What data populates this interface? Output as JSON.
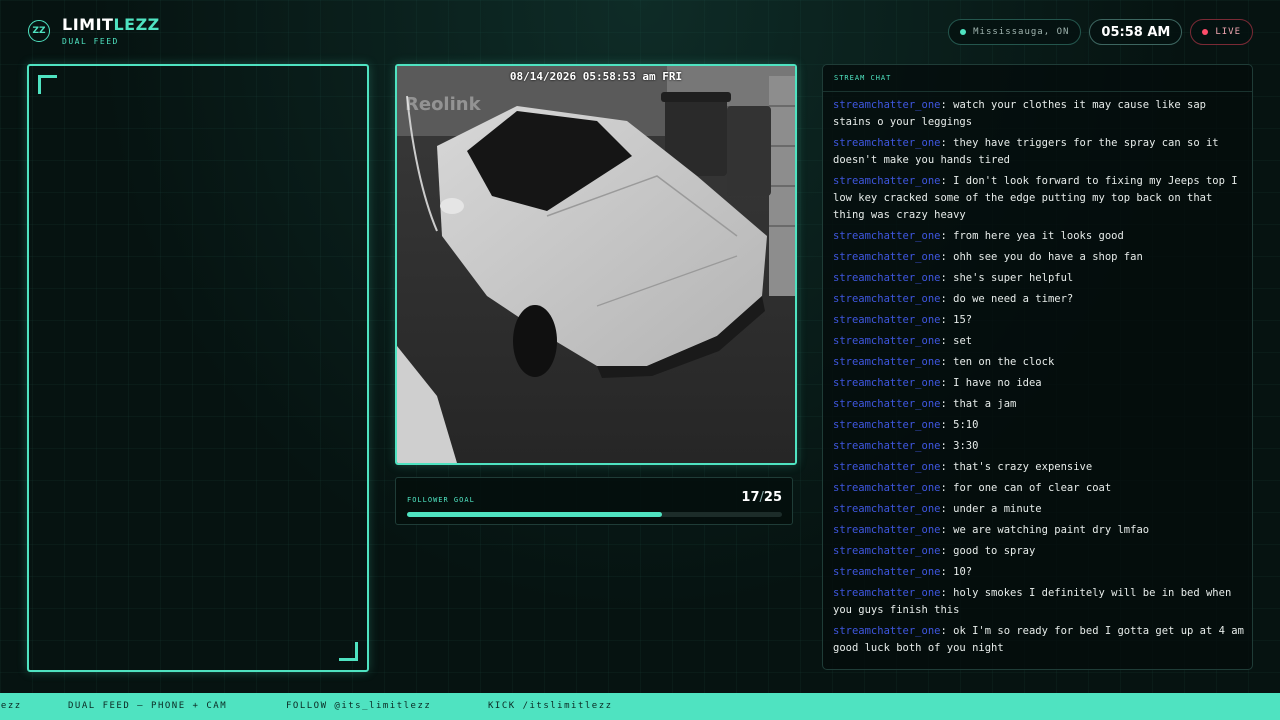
{
  "brand": {
    "logo_text": "ZZ",
    "name_part1": "LIMIT",
    "name_part2": "LEZZ",
    "subtitle": "DUAL FEED"
  },
  "status": {
    "location": "Mississauga, ON",
    "clock": "05:58 AM",
    "live_label": "LIVE"
  },
  "camera": {
    "timestamp": "08/14/2026 05:58:53 am FRI",
    "watermark": "Reolink"
  },
  "goal": {
    "label": "FOLLOWER GOAL",
    "current": "17",
    "separator": "/",
    "target": "25",
    "progress": 0.68
  },
  "chat": {
    "title": "STREAM CHAT",
    "messages": [
      {
        "user": "streamchatter_one",
        "text": "watch your clothes it may cause like sap stains o your leggings"
      },
      {
        "user": "streamchatter_one",
        "text": "they have triggers for the spray can so it doesn't make you hands tired"
      },
      {
        "user": "streamchatter_one",
        "text": "I don't look forward to fixing my Jeeps top I low key cracked some of the edge putting my top back on that thing was crazy heavy"
      },
      {
        "user": "streamchatter_one",
        "text": "from here yea it looks good"
      },
      {
        "user": "streamchatter_one",
        "text": "ohh see you do have a shop fan"
      },
      {
        "user": "streamchatter_one",
        "text": "she's super helpful"
      },
      {
        "user": "streamchatter_one",
        "text": "do we need a timer?"
      },
      {
        "user": "streamchatter_one",
        "text": "15?"
      },
      {
        "user": "streamchatter_one",
        "text": "set"
      },
      {
        "user": "streamchatter_one",
        "text": "ten on the clock"
      },
      {
        "user": "streamchatter_one",
        "text": "I have no idea"
      },
      {
        "user": "streamchatter_one",
        "text": "that a jam"
      },
      {
        "user": "streamchatter_one",
        "text": "5:10"
      },
      {
        "user": "streamchatter_one",
        "text": "3:30"
      },
      {
        "user": "streamchatter_one",
        "text": "that's crazy expensive"
      },
      {
        "user": "streamchatter_one",
        "text": "for one can of clear coat"
      },
      {
        "user": "streamchatter_one",
        "text": "under a minute"
      },
      {
        "user": "streamchatter_one",
        "text": "we are watching paint dry lmfao"
      },
      {
        "user": "streamchatter_one",
        "text": "good to spray"
      },
      {
        "user": "streamchatter_one",
        "text": "10?"
      },
      {
        "user": "streamchatter_one",
        "text": "holy smokes I definitely will be in bed when you guys finish this"
      },
      {
        "user": "streamchatter_one",
        "text": "ok I'm so ready for bed I gotta get up at 4 am good luck both of you night"
      }
    ]
  },
  "ticker": {
    "items": [
      "lezz",
      "DUAL FEED — PHONE + CAM",
      "FOLLOW @its_limitlezz",
      "KICK /itslimitlezz"
    ]
  },
  "colors": {
    "accent": "#4fe3c1",
    "live": "#ff4d6a",
    "username": "#3f57e0",
    "background": "#061311"
  }
}
